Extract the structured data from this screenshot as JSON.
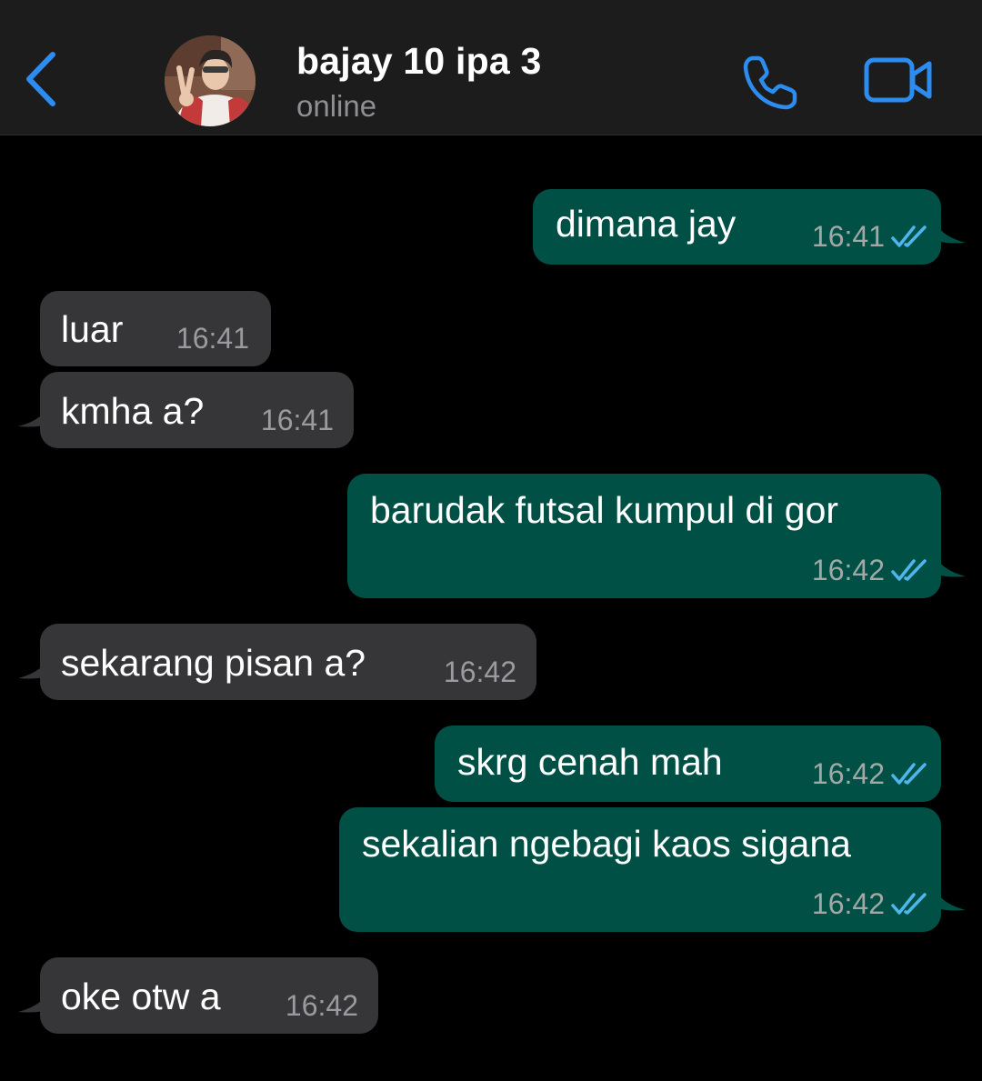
{
  "header": {
    "contact_name": "bajay 10 ipa 3",
    "status": "online",
    "accent_color": "#2d8cf0"
  },
  "colors": {
    "outgoing_bubble": "#005046",
    "incoming_bubble": "#363638",
    "read_ticks": "#4fb6ec"
  },
  "messages": [
    {
      "direction": "out",
      "text": "dimana jay",
      "time": "16:41",
      "read": true
    },
    {
      "direction": "in",
      "text": "luar",
      "time": "16:41"
    },
    {
      "direction": "in",
      "text": "kmha a?",
      "time": "16:41"
    },
    {
      "direction": "out",
      "text": "barudak futsal kumpul di gor",
      "time": "16:42",
      "read": true
    },
    {
      "direction": "in",
      "text": "sekarang pisan a?",
      "time": "16:42"
    },
    {
      "direction": "out",
      "text": "skrg cenah mah",
      "time": "16:42",
      "read": true
    },
    {
      "direction": "out",
      "text": "sekalian ngebagi kaos sigana",
      "time": "16:42",
      "read": true
    },
    {
      "direction": "in",
      "text": "oke otw a",
      "time": "16:42"
    }
  ]
}
